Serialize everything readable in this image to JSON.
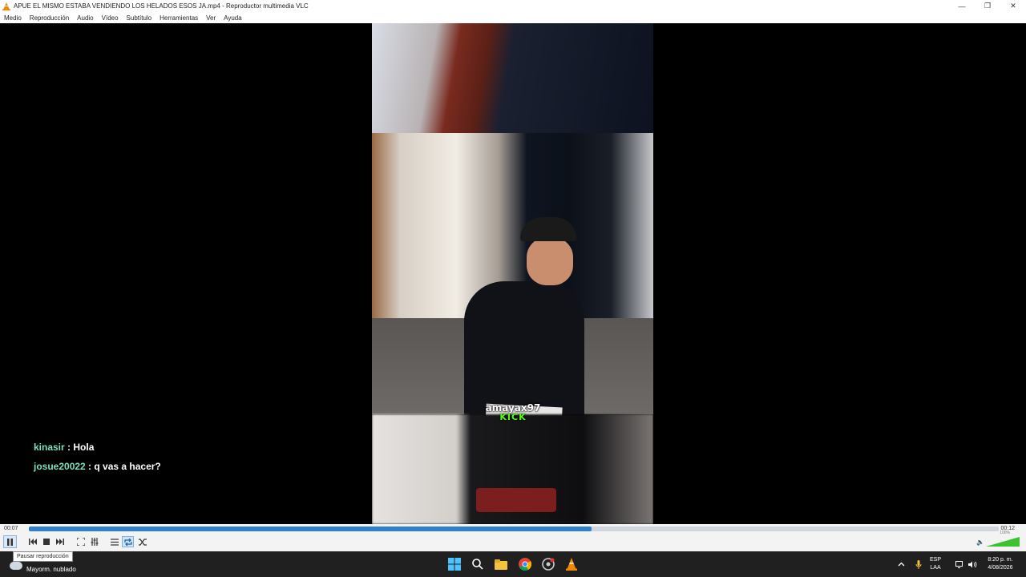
{
  "window": {
    "title": "APUE EL MISMO ESTABA VENDIENDO LOS HELADOS ESOS JA.mp4 - Reproductor multimedia VLC",
    "controls": [
      "—",
      "❐",
      "✕"
    ]
  },
  "menu": [
    "Medio",
    "Reproducción",
    "Audio",
    "Vídeo",
    "Subtítulo",
    "Herramientas",
    "Ver",
    "Ayuda"
  ],
  "video": {
    "watermark_user": "amayax97",
    "watermark_brand": "KICK"
  },
  "chat": [
    {
      "user": "kinasir",
      "message": " : Hola"
    },
    {
      "user": "josue20022",
      "message": " : q vas a hacer?"
    }
  ],
  "playback": {
    "elapsed": "00:07",
    "total": "00:12",
    "progress_fraction": 0.58,
    "volume_label": "100%",
    "volume_fraction": 1.0,
    "tooltip": "Pausar reproducción"
  },
  "taskbar": {
    "weather": "Mayorm. nublado",
    "lang_top": "ESP",
    "lang_bottom": "LAA",
    "time": "8:20 p. m.",
    "date": "4/08/2026"
  },
  "colors": {
    "seek_fill": "#2f81d0",
    "volume_fill": "#3bc22f",
    "chat_user": "#7ee0c0",
    "kick_green": "#53fc18"
  }
}
